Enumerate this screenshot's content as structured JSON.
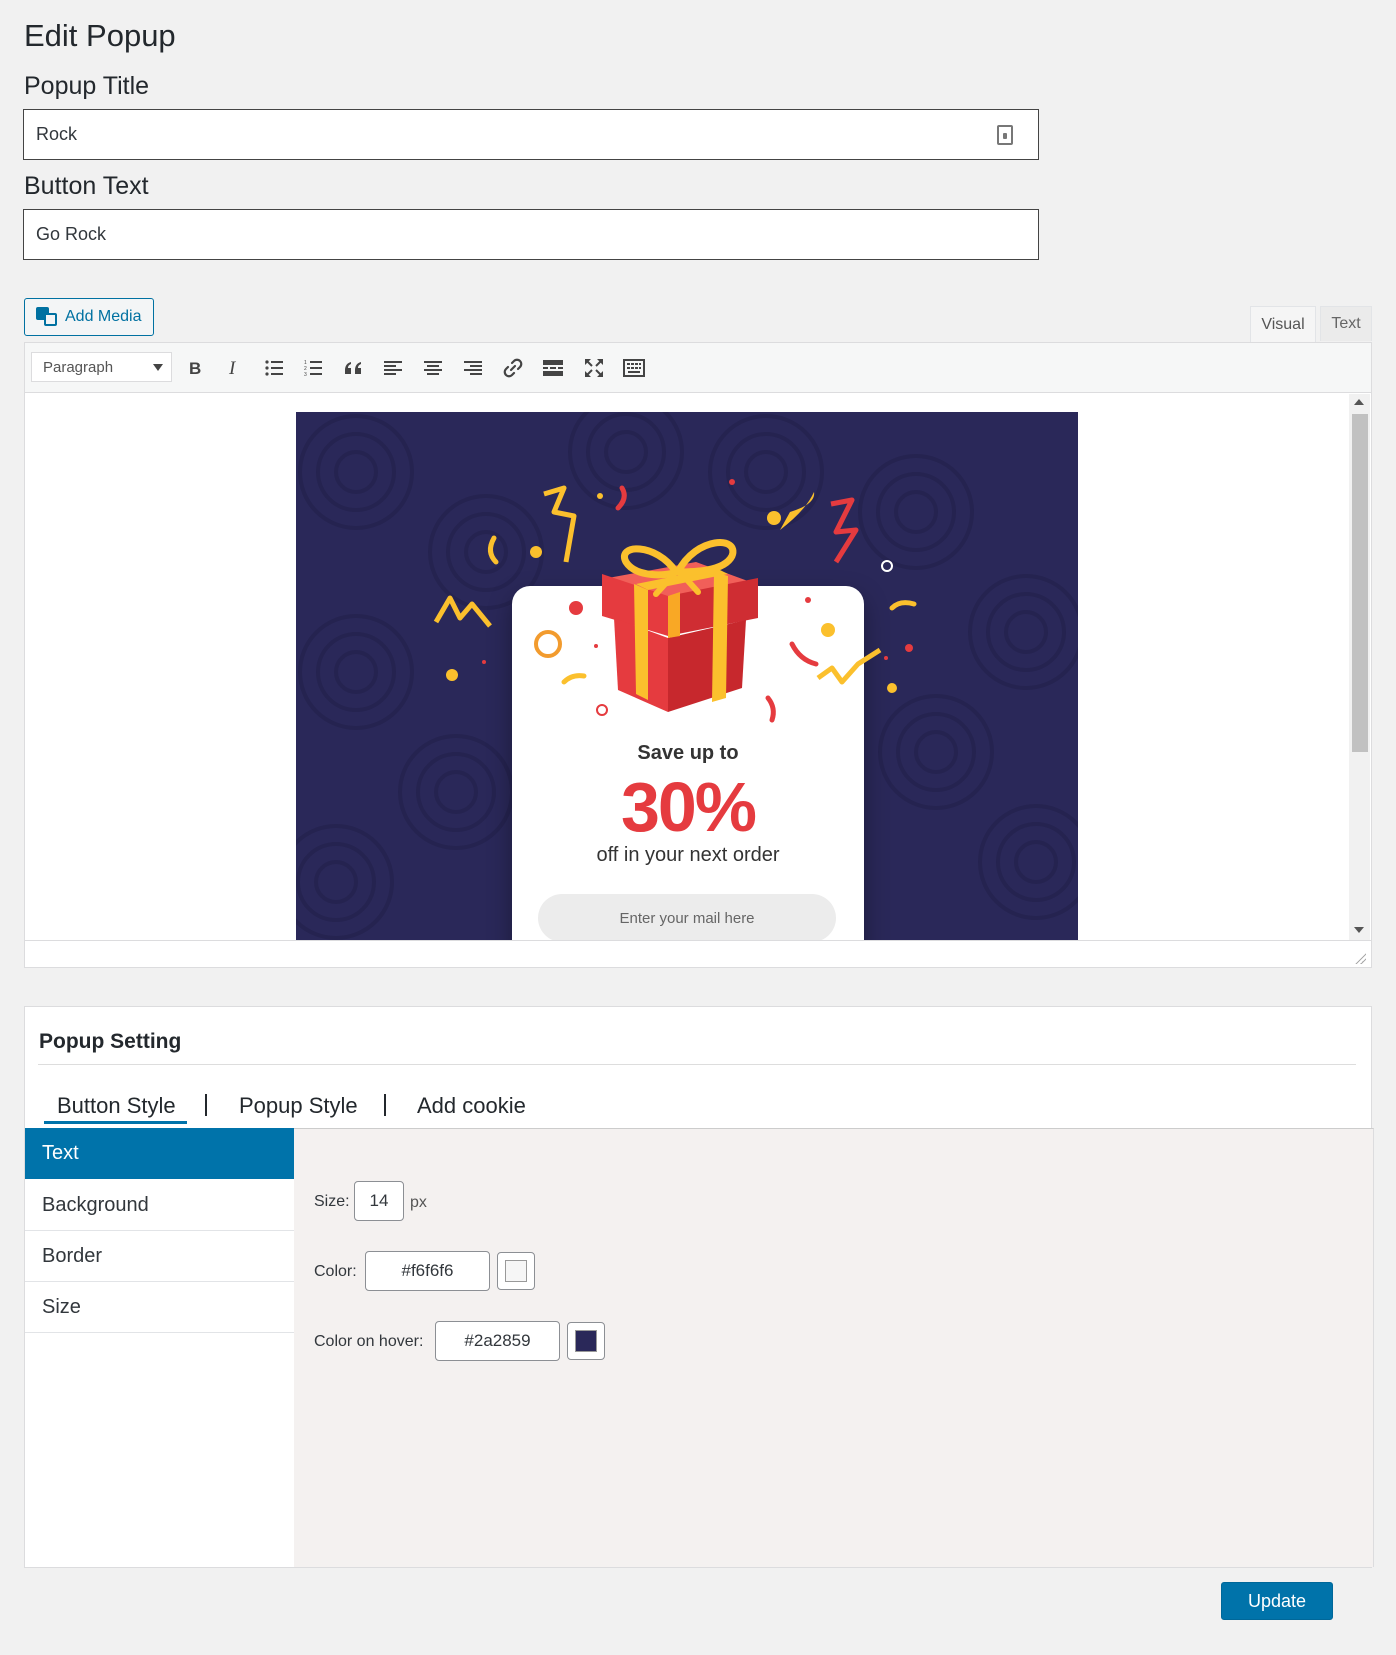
{
  "page": {
    "title": "Edit Popup"
  },
  "fields": {
    "popup_title": {
      "label": "Popup Title",
      "value": "Rock"
    },
    "button_text": {
      "label": "Button Text",
      "value": "Go Rock"
    }
  },
  "editor": {
    "add_media_label": "Add Media",
    "tabs": {
      "visual": "Visual",
      "text": "Text"
    },
    "format_select": "Paragraph",
    "toolbar_icons": [
      "bold-icon",
      "italic-icon",
      "bullet-list-icon",
      "numbered-list-icon",
      "blockquote-icon",
      "align-left-icon",
      "align-center-icon",
      "align-right-icon",
      "link-icon",
      "read-more-icon",
      "fullscreen-icon",
      "toolbar-toggle-icon"
    ],
    "content_image": {
      "headline": "Save up to",
      "discount": "30%",
      "subline": "off in your next order",
      "email_placeholder": "Enter your mail here",
      "colors": {
        "background": "#2a2859",
        "accent": "#e53b3f",
        "ribbon": "#fbc02d"
      }
    }
  },
  "settings": {
    "title": "Popup Setting",
    "tabs": [
      "Button Style",
      "Popup Style",
      "Add cookie"
    ],
    "active_tab": "Button Style",
    "sidebar": [
      "Text",
      "Background",
      "Border",
      "Size"
    ],
    "active_sidebar": "Text",
    "text_panel": {
      "size_label": "Size:",
      "size_value": "14",
      "size_unit": "px",
      "color_label": "Color:",
      "color_value": "#f6f6f6",
      "hover_label": "Color on hover:",
      "hover_value": "#2a2859"
    }
  },
  "actions": {
    "update_label": "Update"
  },
  "theme": {
    "primary": "#0073aa"
  }
}
